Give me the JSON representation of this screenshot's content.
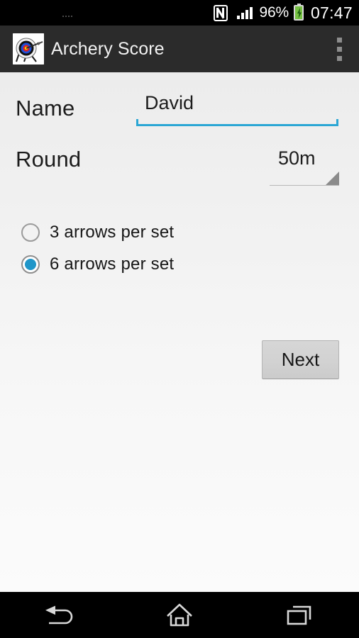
{
  "status_bar": {
    "nfc_icon": "nfc-icon",
    "signal_icon": "signal-bars-icon",
    "battery_percent": "96%",
    "battery_icon": "battery-charging-icon",
    "time": "07:47"
  },
  "action_bar": {
    "app_icon": "archery-target-icon",
    "title": "Archery Score",
    "overflow_icon": "overflow-menu-icon"
  },
  "form": {
    "name": {
      "label": "Name",
      "value": "David",
      "placeholder": "Name"
    },
    "round": {
      "label": "Round",
      "value": "50m",
      "dropdown_icon": "spinner-triangle-icon"
    },
    "arrows_per_set": {
      "options": [
        {
          "label": "3 arrows per set",
          "checked": false
        },
        {
          "label": "6 arrows per set",
          "checked": true
        }
      ]
    },
    "next_button": "Next"
  },
  "nav_bar": {
    "back": "back-icon",
    "home": "home-icon",
    "recents": "recents-icon"
  },
  "colors": {
    "accent_blue": "#2ba6d4",
    "radio_blue": "#1f96c9",
    "action_bar": "#2b2b2b",
    "status_bar": "#000000",
    "content_bg": "#ececec",
    "battery_green": "#76c043"
  }
}
